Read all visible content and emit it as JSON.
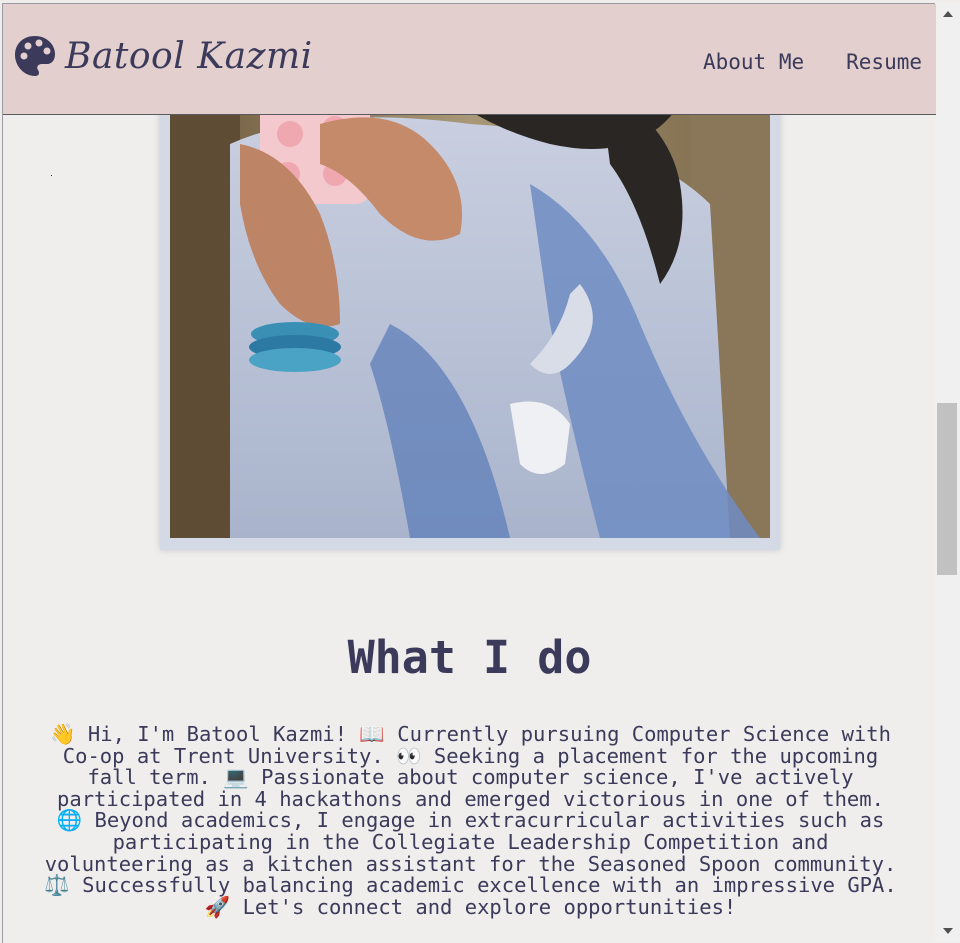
{
  "navbar": {
    "brand_name": "Batool Kazmi",
    "brand_icon": "palette-icon",
    "links": [
      {
        "label": "About Me"
      },
      {
        "label": "Resume"
      }
    ]
  },
  "hero_photo": {
    "alt": "Photo"
  },
  "what_i_do": {
    "title": "What I do",
    "description": "👋 Hi, I'm Batool Kazmi! 📖 Currently pursuing Computer Science with Co-op at Trent University. 👀 Seeking a placement for the upcoming fall term. 💻 Passionate about computer science, I've actively participated in 4 hackathons and emerged victorious in one of them. 🌐 Beyond academics, I engage in extracurricular activities such as participating in the Collegiate Leadership Competition and volunteering as a kitchen assistant for the Seasoned Spoon community. ⚖️ Successfully balancing academic excellence with an impressive GPA. 🚀 Let's connect and explore opportunities!"
  },
  "scrollbar": {
    "up_icon": "scroll-up-arrow-icon",
    "down_icon": "scroll-down-arrow-icon"
  },
  "colors": {
    "navbar_bg": "#e3cfce",
    "page_bg": "#efeeec",
    "text": "#3b3a5a",
    "photo_frame": "#d3dae6"
  }
}
